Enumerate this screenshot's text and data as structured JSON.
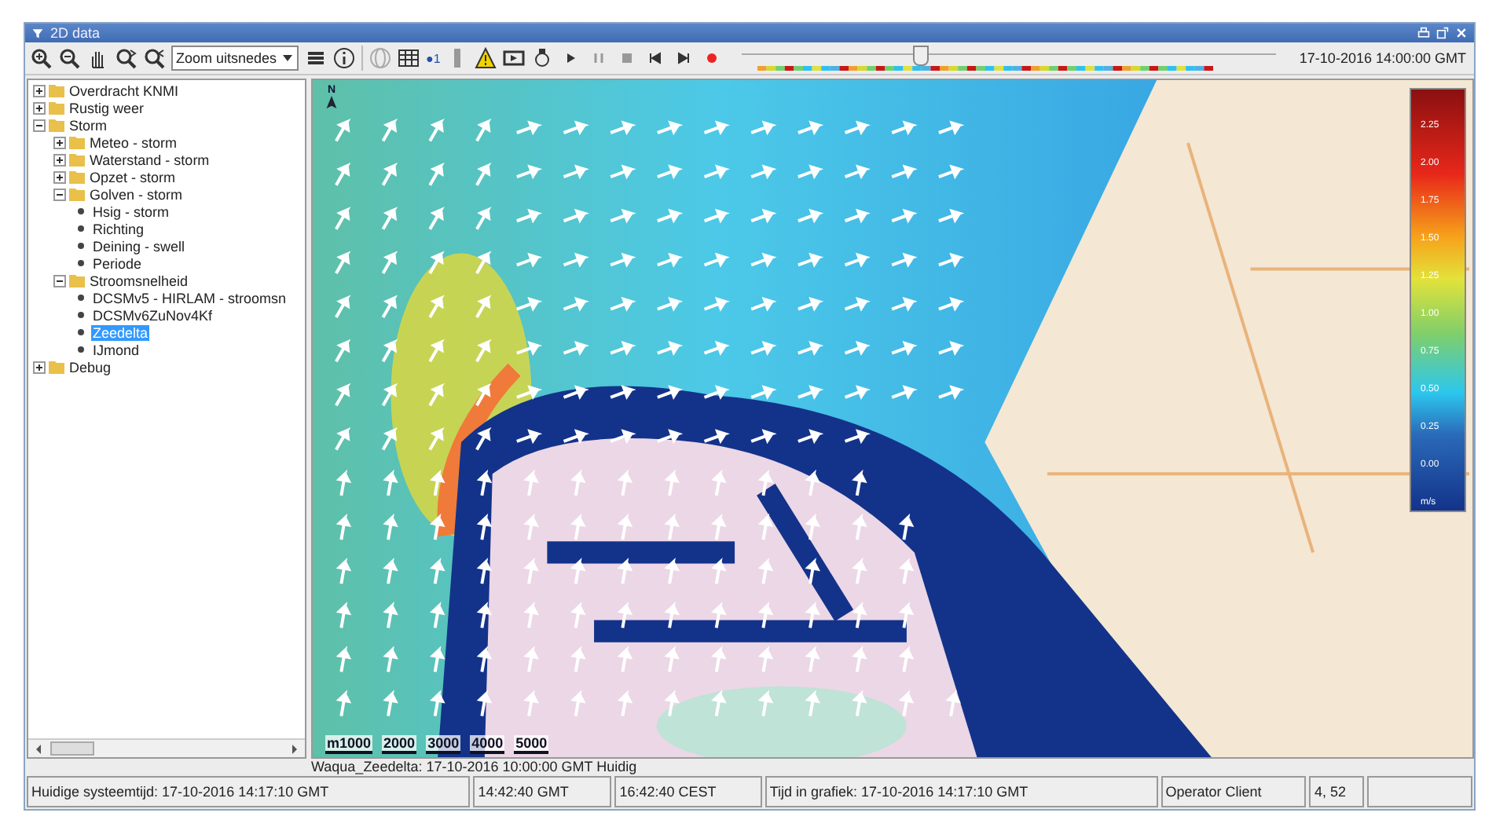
{
  "window": {
    "title": "2D data"
  },
  "toolbar": {
    "zoom_select": {
      "value": "Zoom uitsnedes"
    },
    "layer_badge": "●1",
    "time_slider": {
      "level": 0.33
    },
    "time": "17-10-2016 14:00:00 GMT"
  },
  "tree": [
    {
      "label": "Overdracht KNMI",
      "kind": "folder",
      "expanded": false,
      "selected": false
    },
    {
      "label": "Rustig weer",
      "kind": "folder",
      "expanded": false,
      "selected": false
    },
    {
      "label": "Storm",
      "kind": "folder",
      "expanded": true,
      "selected": false,
      "children": [
        {
          "label": "Meteo - storm",
          "kind": "folder",
          "expanded": false,
          "selected": false
        },
        {
          "label": "Waterstand - storm",
          "kind": "folder",
          "expanded": false,
          "selected": false
        },
        {
          "label": "Opzet - storm",
          "kind": "folder",
          "expanded": false,
          "selected": false
        },
        {
          "label": "Golven - storm",
          "kind": "folder",
          "expanded": true,
          "selected": false,
          "children": [
            {
              "label": "Hsig - storm",
              "kind": "layer",
              "selected": false
            },
            {
              "label": "Richting",
              "kind": "layer",
              "selected": false
            },
            {
              "label": "Deining - swell",
              "kind": "layer",
              "selected": false
            },
            {
              "label": "Periode",
              "kind": "layer",
              "selected": false
            }
          ]
        },
        {
          "label": "Stroomsnelheid",
          "kind": "folder",
          "expanded": true,
          "selected": false,
          "children": [
            {
              "label": "DCSMv5 - HIRLAM - stroomsn",
              "kind": "layer",
              "selected": false
            },
            {
              "label": "DCSMv6ZuNov4Kf",
              "kind": "layer",
              "selected": false
            },
            {
              "label": "Zeedelta",
              "kind": "layer",
              "selected": true
            },
            {
              "label": "IJmond",
              "kind": "layer",
              "selected": false
            }
          ]
        }
      ]
    },
    {
      "label": "Debug",
      "kind": "folder",
      "expanded": false,
      "selected": false
    }
  ],
  "map": {
    "north_label": "N",
    "scale_labels": [
      "m1000",
      "2000",
      "3000",
      "4000",
      "5000"
    ],
    "legend": {
      "ticks": [
        "2.25",
        "2.00",
        "1.75",
        "1.50",
        "1.25",
        "1.00",
        "0.75",
        "0.50",
        "0.25",
        "0.00"
      ],
      "unit": "m/s"
    }
  },
  "map_caption": "Waqua_Zeedelta: 17-10-2016 10:00:00 GMT Huidig",
  "status_bar": [
    "Huidige systeemtijd: 17-10-2016 14:17:10 GMT",
    "14:42:40 GMT",
    "16:42:40 CEST",
    "Tijd in grafiek: 17-10-2016 14:17:10 GMT",
    "Operator Client",
    "4, 52"
  ]
}
